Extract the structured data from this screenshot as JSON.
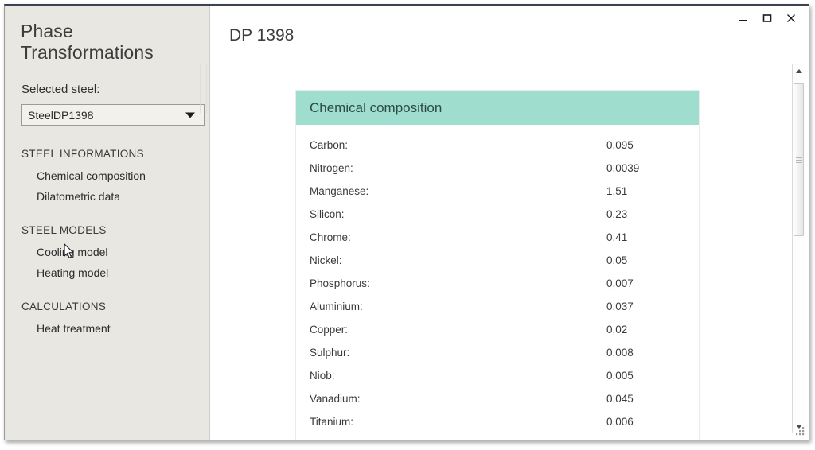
{
  "window": {
    "controls": [
      {
        "name": "minimize",
        "label": "–"
      },
      {
        "name": "maximize",
        "label": "□"
      },
      {
        "name": "close",
        "label": "✕"
      }
    ]
  },
  "sidebar": {
    "app_title": "Phase Transformations",
    "selected_steel_label": "Selected steel:",
    "steel_combo": {
      "value": "SteelDP1398",
      "icon": "chevron-down-icon"
    },
    "groups": [
      {
        "title": "STEEL INFORMATIONS",
        "items": [
          {
            "label": "Chemical composition"
          },
          {
            "label": "Dilatometric data"
          }
        ]
      },
      {
        "title": "STEEL MODELS",
        "items": [
          {
            "label": "Cooling model"
          },
          {
            "label": "Heating model"
          }
        ]
      },
      {
        "title": "CALCULATIONS",
        "items": [
          {
            "label": "Heat treatment"
          }
        ]
      }
    ]
  },
  "main": {
    "page_title": "DP 1398",
    "card": {
      "header": "Chemical composition",
      "rows": [
        {
          "name": "Carbon:",
          "value": "0,095"
        },
        {
          "name": "Nitrogen:",
          "value": "0,0039"
        },
        {
          "name": "Manganese:",
          "value": "1,51"
        },
        {
          "name": "Silicon:",
          "value": "0,23"
        },
        {
          "name": "Chrome:",
          "value": "0,41"
        },
        {
          "name": "Nickel:",
          "value": "0,05"
        },
        {
          "name": "Phosphorus:",
          "value": "0,007"
        },
        {
          "name": "Aluminium:",
          "value": "0,037"
        },
        {
          "name": "Copper:",
          "value": "0,02"
        },
        {
          "name": "Sulphur:",
          "value": "0,008"
        },
        {
          "name": "Niob:",
          "value": "0,005"
        },
        {
          "name": "Vanadium:",
          "value": "0,045"
        },
        {
          "name": "Titanium:",
          "value": "0,006"
        }
      ]
    }
  },
  "colors": {
    "accent_teal": "#9fdece",
    "sidebar_bg": "#e9e7e1",
    "title_bar": "#3b4252"
  }
}
